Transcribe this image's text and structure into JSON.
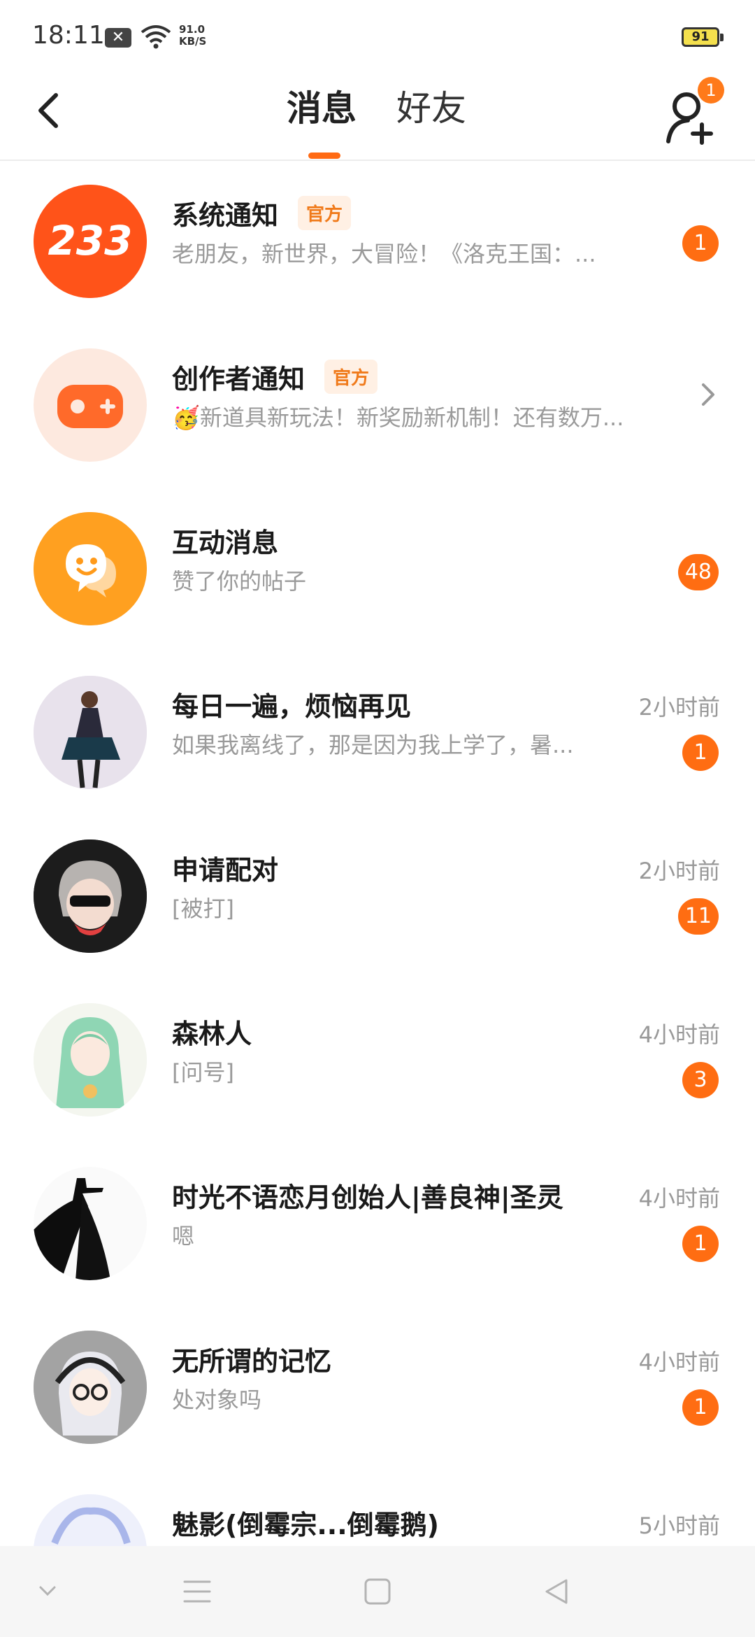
{
  "status_bar": {
    "time": "18:11",
    "speed_value": "91.0",
    "speed_unit": "KB/S",
    "battery": "91"
  },
  "header": {
    "tabs": [
      "消息",
      "好友"
    ],
    "active_tab": "消息",
    "add_friend_badge": "1"
  },
  "official_label": "官方",
  "conversations": [
    {
      "title": "系统通知",
      "official": true,
      "preview": "老朋友，新世界，大冒险！《洛克王国：...",
      "time": "",
      "badge": "1",
      "avatar": "233-logo"
    },
    {
      "title": "创作者通知",
      "official": true,
      "preview": "🥳新道具新玩法！新奖励新机制！还有数万...",
      "time": "",
      "badge": "",
      "avatar": "gamepad-icon"
    },
    {
      "title": "互动消息",
      "official": false,
      "preview": "赞了你的帖子",
      "time": "",
      "badge": "48",
      "avatar": "chat-bubble-icon"
    },
    {
      "title": "每日一遍，烦恼再见",
      "official": false,
      "preview": "如果我离线了，那是因为我上学了，暑...",
      "time": "2小时前",
      "badge": "1",
      "avatar": "user-avatar"
    },
    {
      "title": "申请配对",
      "official": false,
      "preview": "[被打]",
      "time": "2小时前",
      "badge": "11",
      "avatar": "user-avatar"
    },
    {
      "title": "森林人",
      "official": false,
      "preview": "[问号]",
      "time": "4小时前",
      "badge": "3",
      "avatar": "user-avatar"
    },
    {
      "title": "时光不语恋月创始人|善良神|圣灵",
      "official": false,
      "preview": "嗯",
      "time": "4小时前",
      "badge": "1",
      "avatar": "user-avatar"
    },
    {
      "title": "无所谓的记忆",
      "official": false,
      "preview": "处对象吗",
      "time": "4小时前",
      "badge": "1",
      "avatar": "user-avatar"
    },
    {
      "title": "魅影(倒霉宗...倒霉鹅)",
      "official": false,
      "preview": "",
      "time": "5小时前",
      "badge": "",
      "avatar": "user-avatar"
    }
  ],
  "colors": {
    "accent": "#ff6d12",
    "official_bg": "#fff0e4",
    "official_text": "#f07a1a"
  }
}
